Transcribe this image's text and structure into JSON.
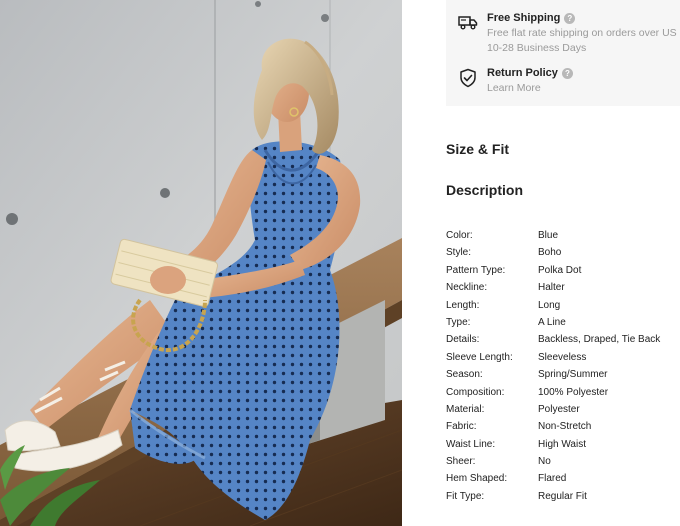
{
  "product_image": {
    "alt": "Model in blue polka dot halter dress",
    "dress_color": "#4f7fc0",
    "dot_color": "#152c52"
  },
  "shipping": {
    "title": "Free Shipping",
    "help_icon": "question-circle-icon",
    "line1": "Free flat rate shipping on orders over US",
    "line2": "10-28 Business Days",
    "icon": "truck-icon"
  },
  "returns": {
    "title": "Return Policy",
    "help_icon": "question-circle-icon",
    "link": "Learn More",
    "icon": "shield-check-icon"
  },
  "sections": {
    "size_fit": "Size & Fit",
    "description": "Description"
  },
  "attributes": [
    {
      "key": "Color:",
      "value": "Blue"
    },
    {
      "key": "Style:",
      "value": "Boho"
    },
    {
      "key": "Pattern Type:",
      "value": "Polka Dot"
    },
    {
      "key": "Neckline:",
      "value": "Halter"
    },
    {
      "key": "Length:",
      "value": "Long"
    },
    {
      "key": "Type:",
      "value": "A Line"
    },
    {
      "key": "Details:",
      "value": "Backless, Draped, Tie Back"
    },
    {
      "key": "Sleeve Length:",
      "value": "Sleeveless"
    },
    {
      "key": "Season:",
      "value": "Spring/Summer"
    },
    {
      "key": "Composition:",
      "value": "100% Polyester"
    },
    {
      "key": "Material:",
      "value": "Polyester"
    },
    {
      "key": "Fabric:",
      "value": "Non-Stretch"
    },
    {
      "key": "Waist Line:",
      "value": "High Waist"
    },
    {
      "key": "Sheer:",
      "value": "No"
    },
    {
      "key": "Hem Shaped:",
      "value": "Flared"
    },
    {
      "key": "Fit Type:",
      "value": "Regular Fit"
    }
  ]
}
